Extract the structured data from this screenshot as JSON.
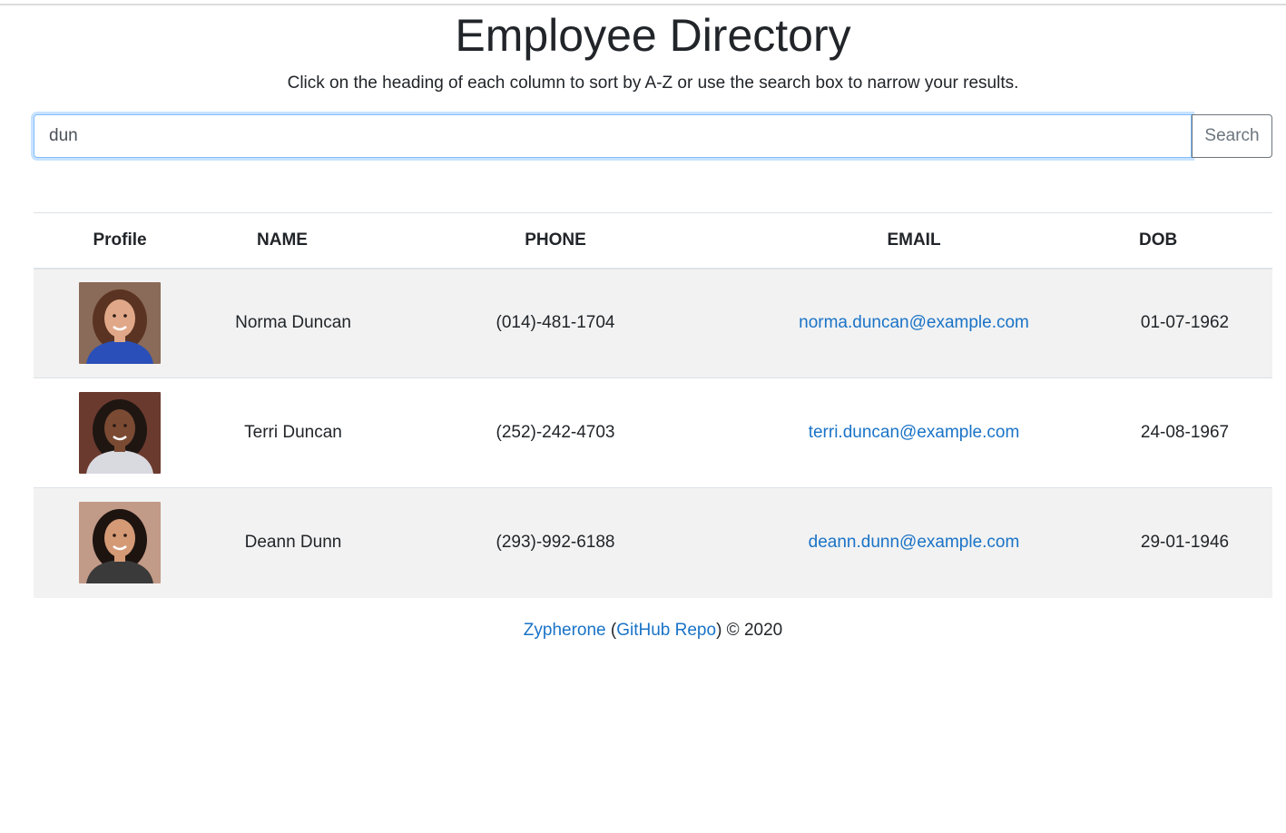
{
  "header": {
    "title": "Employee Directory",
    "subtitle": "Click on the heading of each column to sort by A-Z or use the search box to narrow your results."
  },
  "search": {
    "value": "dun",
    "button_label": "Search"
  },
  "table": {
    "columns": [
      "Profile",
      "NAME",
      "PHONE",
      "EMAIL",
      "DOB"
    ],
    "rows": [
      {
        "name": "Norma Duncan",
        "phone": "(014)-481-1704",
        "email": "norma.duncan@example.com",
        "dob": "01-07-1962",
        "avatar": {
          "bg": "#8a6a58",
          "hair": "#5a3322",
          "skin": "#e0a889",
          "shirt": "#2a4fb8"
        }
      },
      {
        "name": "Terri Duncan",
        "phone": "(252)-242-4703",
        "email": "terri.duncan@example.com",
        "dob": "24-08-1967",
        "avatar": {
          "bg": "#6b3a2e",
          "hair": "#1f1612",
          "skin": "#7a4a33",
          "shirt": "#d9d9e0"
        }
      },
      {
        "name": "Deann Dunn",
        "phone": "(293)-992-6188",
        "email": "deann.dunn@example.com",
        "dob": "29-01-1946",
        "avatar": {
          "bg": "#c29a88",
          "hair": "#1d1410",
          "skin": "#d49a76",
          "shirt": "#3a3a3a"
        }
      }
    ]
  },
  "footer": {
    "author_link": "Zypherone",
    "open_paren": " (",
    "repo_link": "GitHub Repo",
    "copyright": ") © 2020"
  },
  "colors": {
    "link": "#1a73c7",
    "stripe": "#f2f2f2",
    "input_focus": "#80bdff"
  }
}
